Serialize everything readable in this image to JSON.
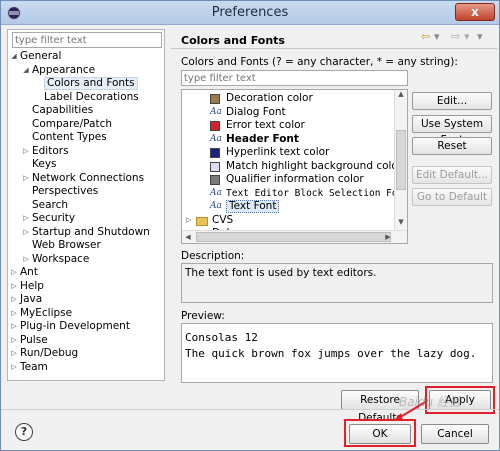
{
  "window": {
    "title": "Preferences",
    "close_label": "x"
  },
  "sidebar": {
    "filter_placeholder": "type filter text",
    "tree": [
      {
        "label": "General",
        "level": 0,
        "twisty": "open"
      },
      {
        "label": "Appearance",
        "level": 1,
        "twisty": "open"
      },
      {
        "label": "Colors and Fonts",
        "level": 2,
        "twisty": "",
        "selected": true
      },
      {
        "label": "Label Decorations",
        "level": 2,
        "twisty": ""
      },
      {
        "label": "Capabilities",
        "level": 1,
        "twisty": ""
      },
      {
        "label": "Compare/Patch",
        "level": 1,
        "twisty": ""
      },
      {
        "label": "Content Types",
        "level": 1,
        "twisty": ""
      },
      {
        "label": "Editors",
        "level": 1,
        "twisty": "closed"
      },
      {
        "label": "Keys",
        "level": 1,
        "twisty": ""
      },
      {
        "label": "Network Connections",
        "level": 1,
        "twisty": "closed"
      },
      {
        "label": "Perspectives",
        "level": 1,
        "twisty": ""
      },
      {
        "label": "Search",
        "level": 1,
        "twisty": ""
      },
      {
        "label": "Security",
        "level": 1,
        "twisty": "closed"
      },
      {
        "label": "Startup and Shutdown",
        "level": 1,
        "twisty": "closed"
      },
      {
        "label": "Web Browser",
        "level": 1,
        "twisty": ""
      },
      {
        "label": "Workspace",
        "level": 1,
        "twisty": "closed"
      },
      {
        "label": "Ant",
        "level": 0,
        "twisty": "closed"
      },
      {
        "label": "Help",
        "level": 0,
        "twisty": "closed"
      },
      {
        "label": "Java",
        "level": 0,
        "twisty": "closed"
      },
      {
        "label": "MyEclipse",
        "level": 0,
        "twisty": "closed"
      },
      {
        "label": "Plug-in Development",
        "level": 0,
        "twisty": "closed"
      },
      {
        "label": "Pulse",
        "level": 0,
        "twisty": "closed"
      },
      {
        "label": "Run/Debug",
        "level": 0,
        "twisty": "closed"
      },
      {
        "label": "Team",
        "level": 0,
        "twisty": "closed"
      }
    ]
  },
  "main": {
    "title": "Colors and Fonts",
    "description_label": "Colors and Fonts (? = any character, * = any string):",
    "filter_placeholder": "type filter text",
    "items": [
      {
        "label": "Decoration color",
        "kind": "swatch",
        "color": "#a0794a"
      },
      {
        "label": "Dialog Font",
        "kind": "font"
      },
      {
        "label": "Error text color",
        "kind": "swatch",
        "color": "#d4222a"
      },
      {
        "label": "Header Font",
        "kind": "font",
        "style": "bold"
      },
      {
        "label": "Hyperlink text color",
        "kind": "swatch",
        "color": "#1a237e"
      },
      {
        "label": "Match highlight background color",
        "kind": "swatch",
        "color": "#dcdcf4"
      },
      {
        "label": "Qualifier information color",
        "kind": "swatch",
        "color": "#7a7a7a"
      },
      {
        "label": "Text Editor Block Selection Font",
        "kind": "font",
        "style": "mono"
      },
      {
        "label": "Text Font",
        "kind": "font",
        "selected": true
      },
      {
        "label": "CVS",
        "kind": "folder"
      },
      {
        "label": "Debug",
        "kind": "folder"
      }
    ],
    "buttons": {
      "edit": "Edit...",
      "use_system_font": "Use System Font",
      "reset": "Reset",
      "edit_default": "Edit Default...",
      "go_to_default": "Go to Default"
    },
    "description_title": "Description:",
    "description_text": "The text font is used by text editors.",
    "preview_title": "Preview:",
    "preview_lines": [
      "Consolas 12",
      "The quick brown fox jumps over the lazy dog."
    ],
    "restore_defaults": "Restore Defaults",
    "apply": "Apply"
  },
  "footer": {
    "ok": "OK",
    "cancel": "Cancel"
  },
  "watermark": "Baidu 经验",
  "nav": {
    "back": "⇦",
    "forward": "⇨",
    "menu": "▾"
  },
  "colors": {
    "highlight_red": "#e0202a",
    "accent": "#b3c9e6"
  }
}
